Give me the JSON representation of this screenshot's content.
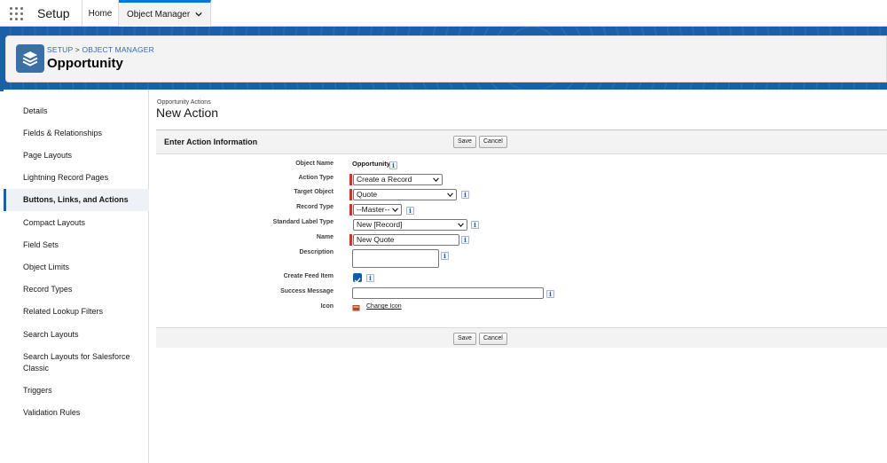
{
  "topbar": {
    "app_name": "Setup",
    "tabs": [
      {
        "label": "Home"
      },
      {
        "label": "Object Manager"
      }
    ]
  },
  "header": {
    "breadcrumb_setup": "SETUP",
    "breadcrumb_sep": ">",
    "breadcrumb_object_manager": "OBJECT MANAGER",
    "title": "Opportunity"
  },
  "sidebar": {
    "items": [
      {
        "label": "Details"
      },
      {
        "label": "Fields & Relationships"
      },
      {
        "label": "Page Layouts"
      },
      {
        "label": "Lightning Record Pages"
      },
      {
        "label": "Buttons, Links, and Actions"
      },
      {
        "label": "Compact Layouts"
      },
      {
        "label": "Field Sets"
      },
      {
        "label": "Object Limits"
      },
      {
        "label": "Record Types"
      },
      {
        "label": "Related Lookup Filters"
      },
      {
        "label": "Search Layouts"
      },
      {
        "label": "Search Layouts for Salesforce Classic"
      },
      {
        "label": "Triggers"
      },
      {
        "label": "Validation Rules"
      }
    ],
    "active_label": "Buttons, Links, and Actions"
  },
  "main": {
    "section_label": "Opportunity Actions",
    "title": "New Action",
    "panel_title": "Enter Action Information",
    "save_label": "Save",
    "cancel_label": "Cancel",
    "info_glyph": "i",
    "form": {
      "object_name": {
        "label": "Object Name",
        "value": "Opportunity"
      },
      "action_type": {
        "label": "Action Type",
        "value": "Create a Record"
      },
      "target_object": {
        "label": "Target Object",
        "value": "Quote"
      },
      "record_type": {
        "label": "Record Type",
        "value": "--Master--"
      },
      "standard_label_type": {
        "label": "Standard Label Type",
        "value": "New [Record]"
      },
      "name": {
        "label": "Name",
        "value": "New Quote"
      },
      "description": {
        "label": "Description",
        "value": ""
      },
      "create_feed_item": {
        "label": "Create Feed Item",
        "checked": true
      },
      "success_message": {
        "label": "Success Message",
        "value": ""
      },
      "icon": {
        "label": "Icon",
        "link": "Change Icon"
      }
    }
  },
  "colors": {
    "brand_blue": "#1b5fa8",
    "required_bar": "#c23934",
    "checkbox": "#0b5cab"
  }
}
